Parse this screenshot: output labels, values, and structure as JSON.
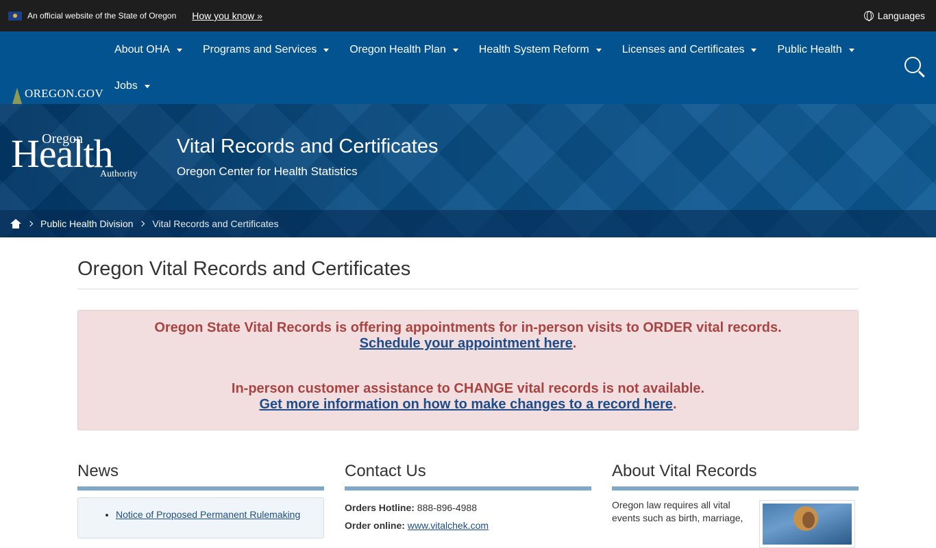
{
  "official_bar": {
    "text": "An official website of the State of Oregon",
    "how_link": "How you know »",
    "languages": "Languages"
  },
  "nav": {
    "logo_text": "OREGON.GOV",
    "items": [
      {
        "label": "About OHA"
      },
      {
        "label": "Programs and Services"
      },
      {
        "label": "Oregon Health Plan"
      },
      {
        "label": "Health System Reform"
      },
      {
        "label": "Licenses and Certificates"
      },
      {
        "label": "Public Health"
      },
      {
        "label": "Jobs"
      }
    ]
  },
  "banner": {
    "logo_oregon": "Oregon",
    "logo_health": "Health",
    "logo_authority": "Authority",
    "title": "Vital Records and Certificates",
    "subtitle": "Oregon Center for Health Statistics"
  },
  "breadcrumb": {
    "items": [
      "Public Health Division",
      "Vital Records and Certificates"
    ]
  },
  "main": {
    "page_title": "Oregon Vital Records and Certificates",
    "alert": {
      "line1": "Oregon State Vital Records is offering appointments for in-person visits to ORDER vital records.",
      "link1": "Schedule your appointment here",
      "line2": "In-person customer assistance to CHANGE vital records is not available.",
      "link2": "Get more information on how to make changes to a record here",
      "period": "."
    }
  },
  "columns": {
    "news": {
      "heading": "News",
      "items": [
        "Notice of Proposed Permanent Rulemaking"
      ]
    },
    "contact": {
      "heading": "Contact Us",
      "hotline_label": "Orders Hotline:",
      "hotline_value": "888-896-4988",
      "online_label": "Order online:",
      "online_value": "www.vitalchek.com"
    },
    "about": {
      "heading": "About Vital Records",
      "text": "Oregon law requires all vital events such as birth, marriage,"
    }
  },
  "colors": {
    "top_bar": "#1e1e1e",
    "nav_bg": "#02538f",
    "alert_bg": "#f2dede",
    "alert_text": "#a94442",
    "link": "#1c4d8a",
    "heading_rule": "#7fa7c9"
  }
}
